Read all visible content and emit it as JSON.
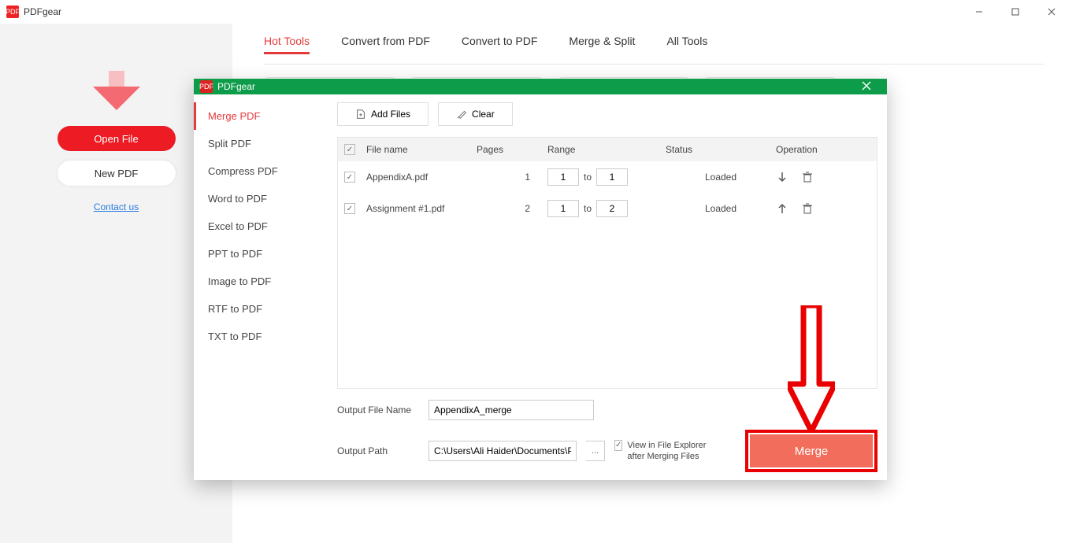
{
  "window": {
    "title": "PDFgear"
  },
  "leftpanel": {
    "open_label": "Open File",
    "new_label": "New PDF",
    "contact": "Contact us"
  },
  "tabs": {
    "hot": "Hot Tools",
    "from": "Convert from PDF",
    "to": "Convert to PDF",
    "merge": "Merge & Split",
    "all": "All Tools"
  },
  "dialog": {
    "title": "PDFgear",
    "sidebar": {
      "items": [
        "Merge PDF",
        "Split PDF",
        "Compress PDF",
        "Word to PDF",
        "Excel to PDF",
        "PPT to PDF",
        "Image to PDF",
        "RTF to PDF",
        "TXT to PDF"
      ]
    },
    "toolbar": {
      "add": "Add Files",
      "clear": "Clear"
    },
    "table": {
      "headers": {
        "file": "File name",
        "pages": "Pages",
        "range": "Range",
        "status": "Status",
        "operation": "Operation"
      },
      "rows": [
        {
          "name": "AppendixA.pdf",
          "pages": "1",
          "from": "1",
          "to_label": "to",
          "to": "1",
          "status": "Loaded"
        },
        {
          "name": "Assignment #1.pdf",
          "pages": "2",
          "from": "1",
          "to_label": "to",
          "to": "2",
          "status": "Loaded"
        }
      ]
    },
    "footer": {
      "outname_label": "Output File Name",
      "outname_value": "AppendixA_merge",
      "outpath_label": "Output Path",
      "outpath_value": "C:\\Users\\Ali Haider\\Documents\\PDF",
      "view_label": "View in File Explorer after Merging Files",
      "merge_label": "Merge"
    }
  }
}
